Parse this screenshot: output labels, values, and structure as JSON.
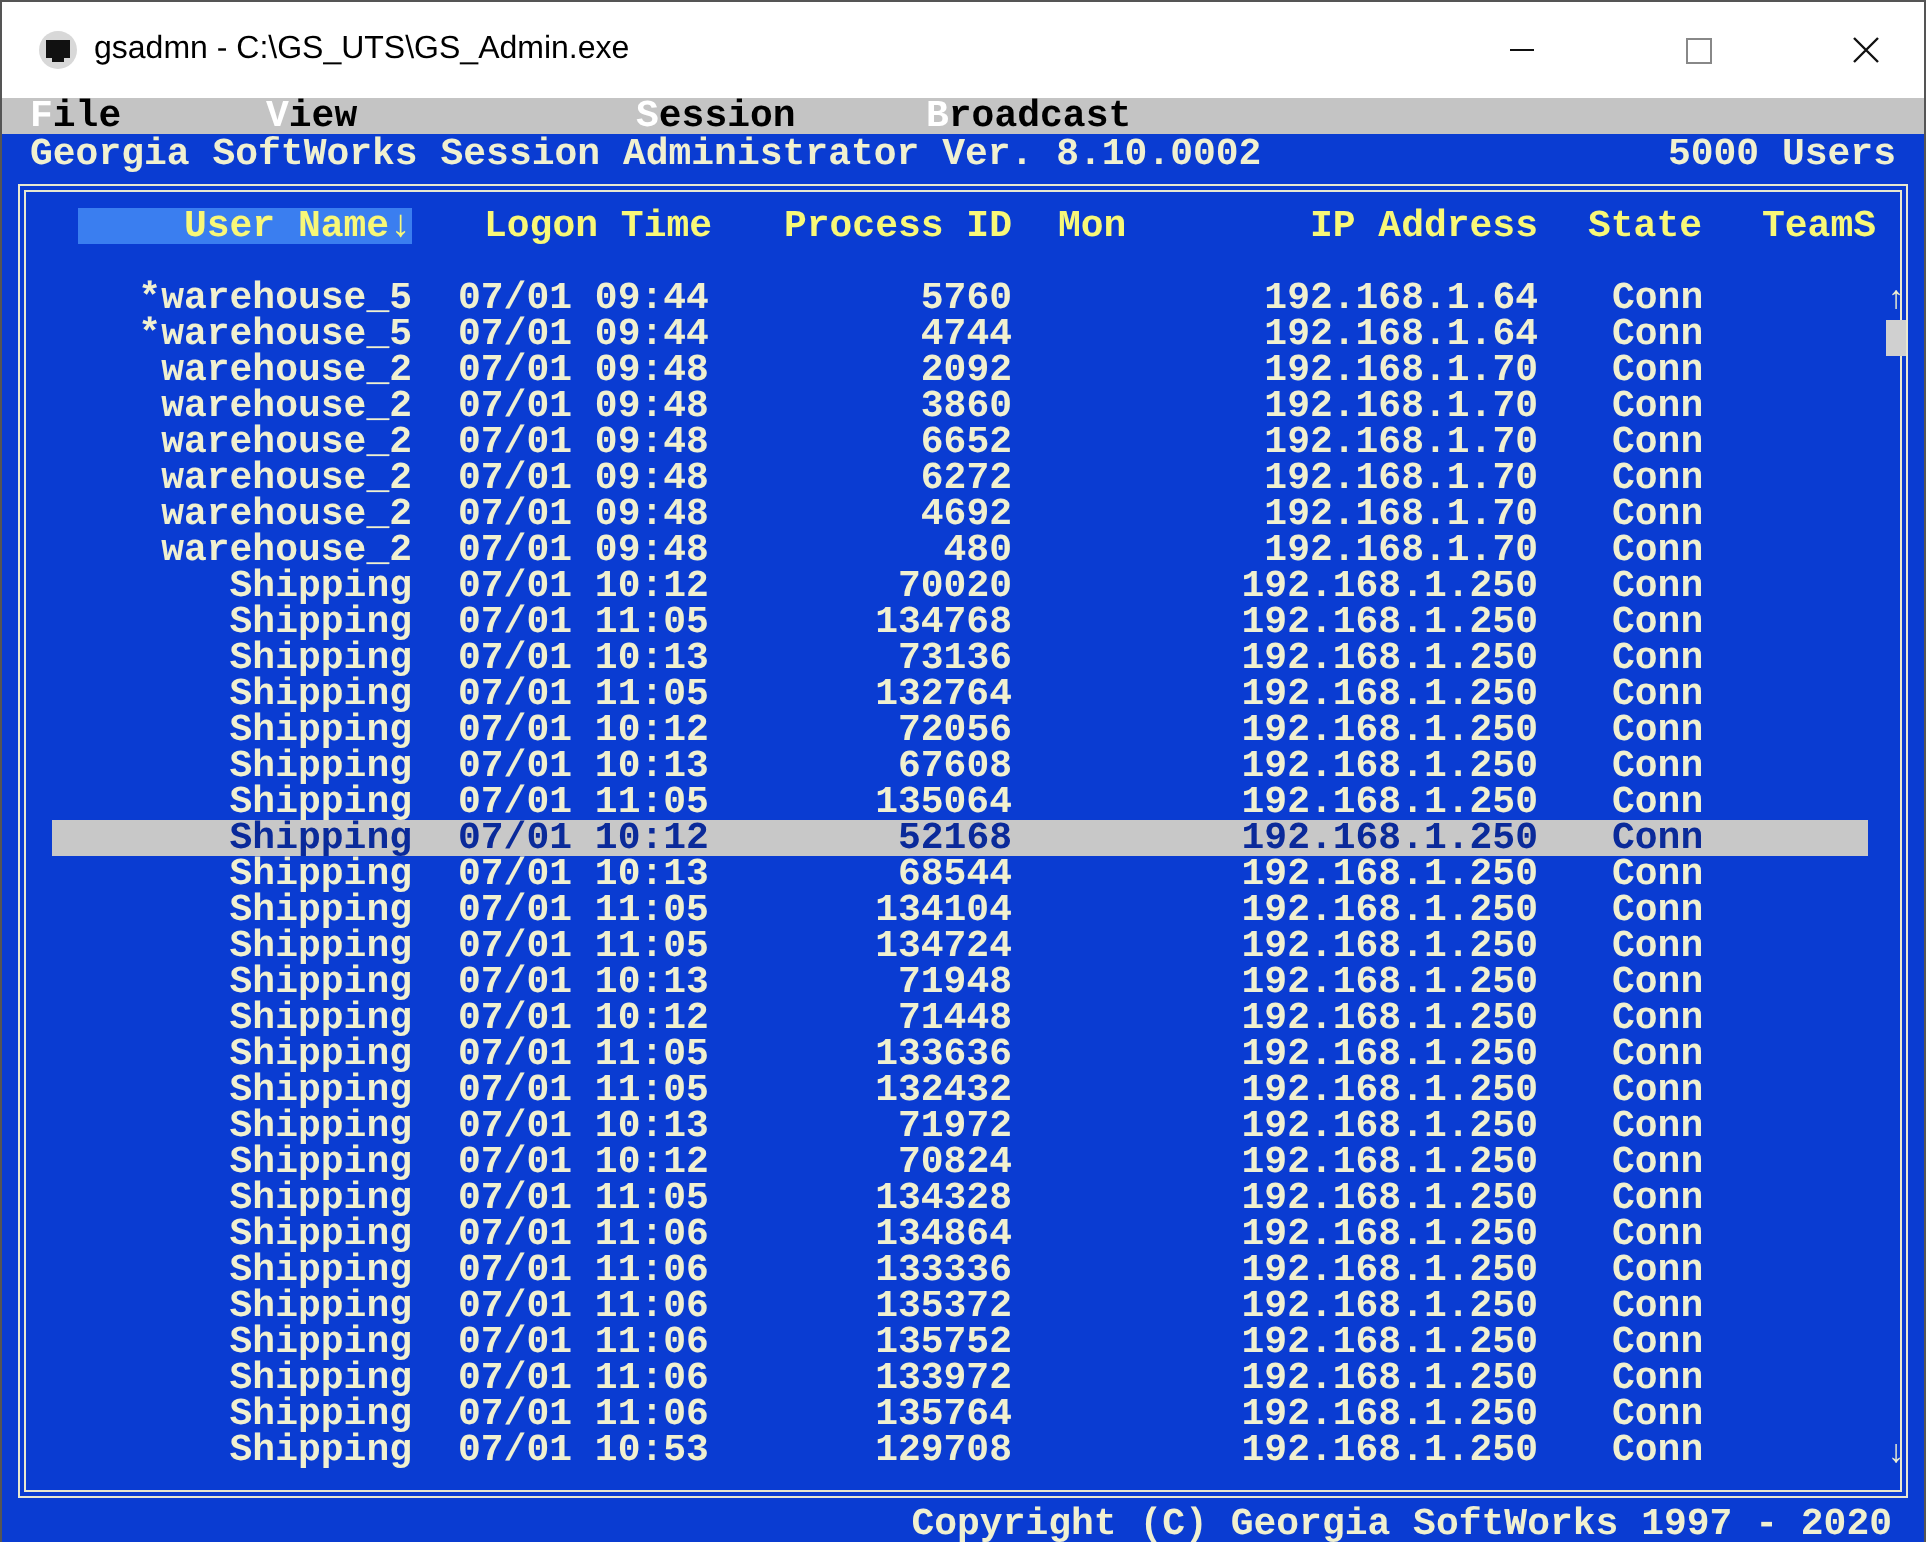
{
  "window": {
    "title": "gsadmn - C:\\GS_UTS\\GS_Admin.exe"
  },
  "menu": [
    "File",
    "View",
    "Session",
    "Broadcast"
  ],
  "info_bar": {
    "title": "Georgia SoftWorks Session Administrator Ver. 8.10.0002",
    "users": "5000 Users"
  },
  "table": {
    "columns": [
      {
        "label": "User Name↓",
        "selected": true
      },
      {
        "label": "Logon Time",
        "selected": false
      },
      {
        "label": "Process ID",
        "selected": false
      },
      {
        "label": "Mon",
        "selected": false
      },
      {
        "label": "IP Address",
        "selected": false
      },
      {
        "label": "State",
        "selected": false
      },
      {
        "label": "TeamS",
        "selected": false
      }
    ],
    "rows": [
      {
        "user": "*warehouse_5",
        "time": "07/01 09:44",
        "pid": "5760",
        "ip": "192.168.1.64",
        "state": "Conn",
        "selected": false
      },
      {
        "user": "*warehouse_5",
        "time": "07/01 09:44",
        "pid": "4744",
        "ip": "192.168.1.64",
        "state": "Conn",
        "selected": false
      },
      {
        "user": "warehouse_2",
        "time": "07/01 09:48",
        "pid": "2092",
        "ip": "192.168.1.70",
        "state": "Conn",
        "selected": false
      },
      {
        "user": "warehouse_2",
        "time": "07/01 09:48",
        "pid": "3860",
        "ip": "192.168.1.70",
        "state": "Conn",
        "selected": false
      },
      {
        "user": "warehouse_2",
        "time": "07/01 09:48",
        "pid": "6652",
        "ip": "192.168.1.70",
        "state": "Conn",
        "selected": false
      },
      {
        "user": "warehouse_2",
        "time": "07/01 09:48",
        "pid": "6272",
        "ip": "192.168.1.70",
        "state": "Conn",
        "selected": false
      },
      {
        "user": "warehouse_2",
        "time": "07/01 09:48",
        "pid": "4692",
        "ip": "192.168.1.70",
        "state": "Conn",
        "selected": false
      },
      {
        "user": "warehouse_2",
        "time": "07/01 09:48",
        "pid": "480",
        "ip": "192.168.1.70",
        "state": "Conn",
        "selected": false
      },
      {
        "user": "Shipping",
        "time": "07/01 10:12",
        "pid": "70020",
        "ip": "192.168.1.250",
        "state": "Conn",
        "selected": false
      },
      {
        "user": "Shipping",
        "time": "07/01 11:05",
        "pid": "134768",
        "ip": "192.168.1.250",
        "state": "Conn",
        "selected": false
      },
      {
        "user": "Shipping",
        "time": "07/01 10:13",
        "pid": "73136",
        "ip": "192.168.1.250",
        "state": "Conn",
        "selected": false
      },
      {
        "user": "Shipping",
        "time": "07/01 11:05",
        "pid": "132764",
        "ip": "192.168.1.250",
        "state": "Conn",
        "selected": false
      },
      {
        "user": "Shipping",
        "time": "07/01 10:12",
        "pid": "72056",
        "ip": "192.168.1.250",
        "state": "Conn",
        "selected": false
      },
      {
        "user": "Shipping",
        "time": "07/01 10:13",
        "pid": "67608",
        "ip": "192.168.1.250",
        "state": "Conn",
        "selected": false
      },
      {
        "user": "Shipping",
        "time": "07/01 11:05",
        "pid": "135064",
        "ip": "192.168.1.250",
        "state": "Conn",
        "selected": false
      },
      {
        "user": "Shipping",
        "time": "07/01 10:12",
        "pid": "52168",
        "ip": "192.168.1.250",
        "state": "Conn",
        "selected": true
      },
      {
        "user": "Shipping",
        "time": "07/01 10:13",
        "pid": "68544",
        "ip": "192.168.1.250",
        "state": "Conn",
        "selected": false
      },
      {
        "user": "Shipping",
        "time": "07/01 11:05",
        "pid": "134104",
        "ip": "192.168.1.250",
        "state": "Conn",
        "selected": false
      },
      {
        "user": "Shipping",
        "time": "07/01 11:05",
        "pid": "134724",
        "ip": "192.168.1.250",
        "state": "Conn",
        "selected": false
      },
      {
        "user": "Shipping",
        "time": "07/01 10:13",
        "pid": "71948",
        "ip": "192.168.1.250",
        "state": "Conn",
        "selected": false
      },
      {
        "user": "Shipping",
        "time": "07/01 10:12",
        "pid": "71448",
        "ip": "192.168.1.250",
        "state": "Conn",
        "selected": false
      },
      {
        "user": "Shipping",
        "time": "07/01 11:05",
        "pid": "133636",
        "ip": "192.168.1.250",
        "state": "Conn",
        "selected": false
      },
      {
        "user": "Shipping",
        "time": "07/01 11:05",
        "pid": "132432",
        "ip": "192.168.1.250",
        "state": "Conn",
        "selected": false
      },
      {
        "user": "Shipping",
        "time": "07/01 10:13",
        "pid": "71972",
        "ip": "192.168.1.250",
        "state": "Conn",
        "selected": false
      },
      {
        "user": "Shipping",
        "time": "07/01 10:12",
        "pid": "70824",
        "ip": "192.168.1.250",
        "state": "Conn",
        "selected": false
      },
      {
        "user": "Shipping",
        "time": "07/01 11:05",
        "pid": "134328",
        "ip": "192.168.1.250",
        "state": "Conn",
        "selected": false
      },
      {
        "user": "Shipping",
        "time": "07/01 11:06",
        "pid": "134864",
        "ip": "192.168.1.250",
        "state": "Conn",
        "selected": false
      },
      {
        "user": "Shipping",
        "time": "07/01 11:06",
        "pid": "133336",
        "ip": "192.168.1.250",
        "state": "Conn",
        "selected": false
      },
      {
        "user": "Shipping",
        "time": "07/01 11:06",
        "pid": "135372",
        "ip": "192.168.1.250",
        "state": "Conn",
        "selected": false
      },
      {
        "user": "Shipping",
        "time": "07/01 11:06",
        "pid": "135752",
        "ip": "192.168.1.250",
        "state": "Conn",
        "selected": false
      },
      {
        "user": "Shipping",
        "time": "07/01 11:06",
        "pid": "133972",
        "ip": "192.168.1.250",
        "state": "Conn",
        "selected": false
      },
      {
        "user": "Shipping",
        "time": "07/01 11:06",
        "pid": "135764",
        "ip": "192.168.1.250",
        "state": "Conn",
        "selected": false
      },
      {
        "user": "Shipping",
        "time": "07/01 10:53",
        "pid": "129708",
        "ip": "192.168.1.250",
        "state": "Conn",
        "selected": false
      }
    ]
  },
  "scrollbar": {
    "up": "↑",
    "down": "↓"
  },
  "status_bar": {
    "copyright": "Copyright (C) Georgia SoftWorks 1997 - 2020"
  }
}
